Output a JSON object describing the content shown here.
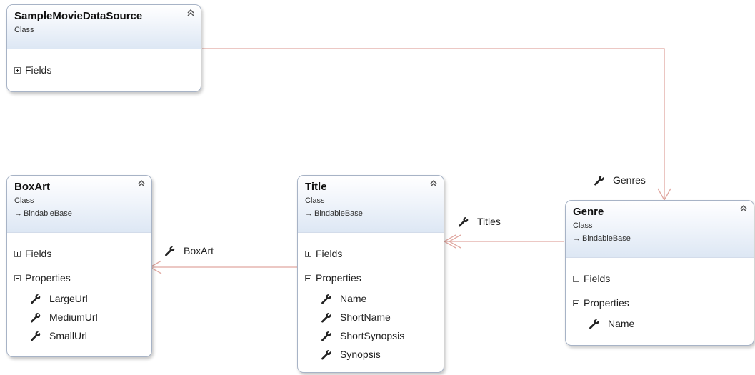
{
  "colors": {
    "connector": "#e0a7a0",
    "border": "#a7b3c6",
    "header_gradient_end": "#dde7f4"
  },
  "classes": {
    "sample": {
      "name": "SampleMovieDataSource",
      "stereotype": "Class",
      "fields_label": "Fields"
    },
    "boxart": {
      "name": "BoxArt",
      "stereotype": "Class",
      "base": "BindableBase",
      "fields_label": "Fields",
      "properties_label": "Properties",
      "properties": [
        "LargeUrl",
        "MediumUrl",
        "SmallUrl"
      ]
    },
    "title": {
      "name": "Title",
      "stereotype": "Class",
      "base": "BindableBase",
      "fields_label": "Fields",
      "properties_label": "Properties",
      "properties": [
        "Name",
        "ShortName",
        "ShortSynopsis",
        "Synopsis"
      ]
    },
    "genre": {
      "name": "Genre",
      "stereotype": "Class",
      "base": "BindableBase",
      "fields_label": "Fields",
      "properties_label": "Properties",
      "properties": [
        "Name"
      ]
    }
  },
  "associations": {
    "genres": "Genres",
    "titles": "Titles",
    "boxart": "BoxArt"
  },
  "icons": {
    "collapse": "double-chevron-up-icon",
    "property": "wrench-icon",
    "inherits": "inheritance-arrow-icon"
  }
}
